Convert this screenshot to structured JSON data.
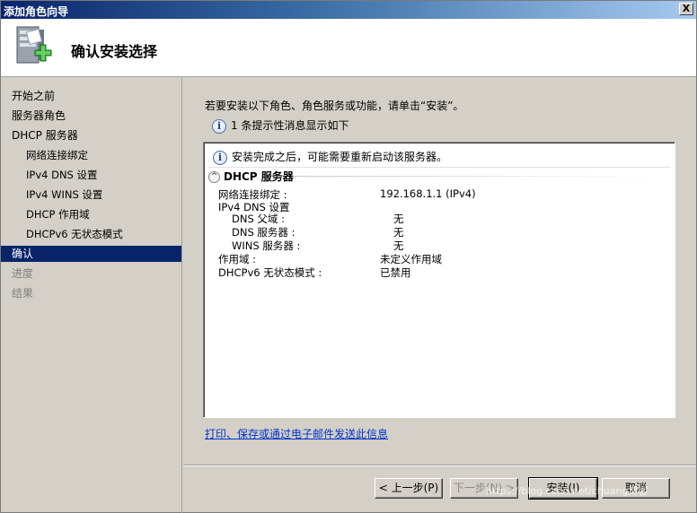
{
  "window": {
    "title": "添加角色向导",
    "close_label": "X"
  },
  "header": {
    "heading": "确认安装选择",
    "icon": "server-add-icon"
  },
  "nav": {
    "items": [
      {
        "label": "开始之前",
        "state": "normal"
      },
      {
        "label": "服务器角色",
        "state": "normal"
      },
      {
        "label": "DHCP 服务器",
        "state": "normal"
      },
      {
        "label": "网络连接绑定",
        "state": "normal"
      },
      {
        "label": "IPv4 DNS 设置",
        "state": "normal"
      },
      {
        "label": "IPv4 WINS 设置",
        "state": "normal"
      },
      {
        "label": "DHCP 作用域",
        "state": "normal"
      },
      {
        "label": "DHCPv6 无状态模式",
        "state": "normal"
      },
      {
        "label": "确认",
        "state": "active"
      },
      {
        "label": "进度",
        "state": "disabled"
      },
      {
        "label": "结果",
        "state": "disabled"
      }
    ]
  },
  "content": {
    "intro": "若要安装以下角色、角色服务或功能，请单击“安装”。",
    "notice": "1 条提示性消息显示如下",
    "panel": {
      "warning": "安装完成之后，可能需要重新启动该服务器。",
      "section_title": "DHCP 服务器",
      "rows": [
        {
          "label": "网络连接绑定 :",
          "value": "192.168.1.1 (IPv4)"
        },
        {
          "label": "IPv4 DNS 设置",
          "value": ""
        },
        {
          "label": "DNS 父域 :",
          "value": "无"
        },
        {
          "label": "DNS 服务器 :",
          "value": "无"
        },
        {
          "label": "WINS 服务器 :",
          "value": "无"
        },
        {
          "label": "作用域 :",
          "value": "未定义作用域"
        },
        {
          "label": "DHCPv6 无状态模式 :",
          "value": "已禁用"
        }
      ]
    },
    "link": "打印、保存或通过电子邮件发送此信息"
  },
  "buttons": {
    "back": "< 上一步(P)",
    "next": "下一步(N) >",
    "install": "安装(I)",
    "cancel": "取消"
  },
  "watermark": "https://blog.csdn.net/chuang博客"
}
